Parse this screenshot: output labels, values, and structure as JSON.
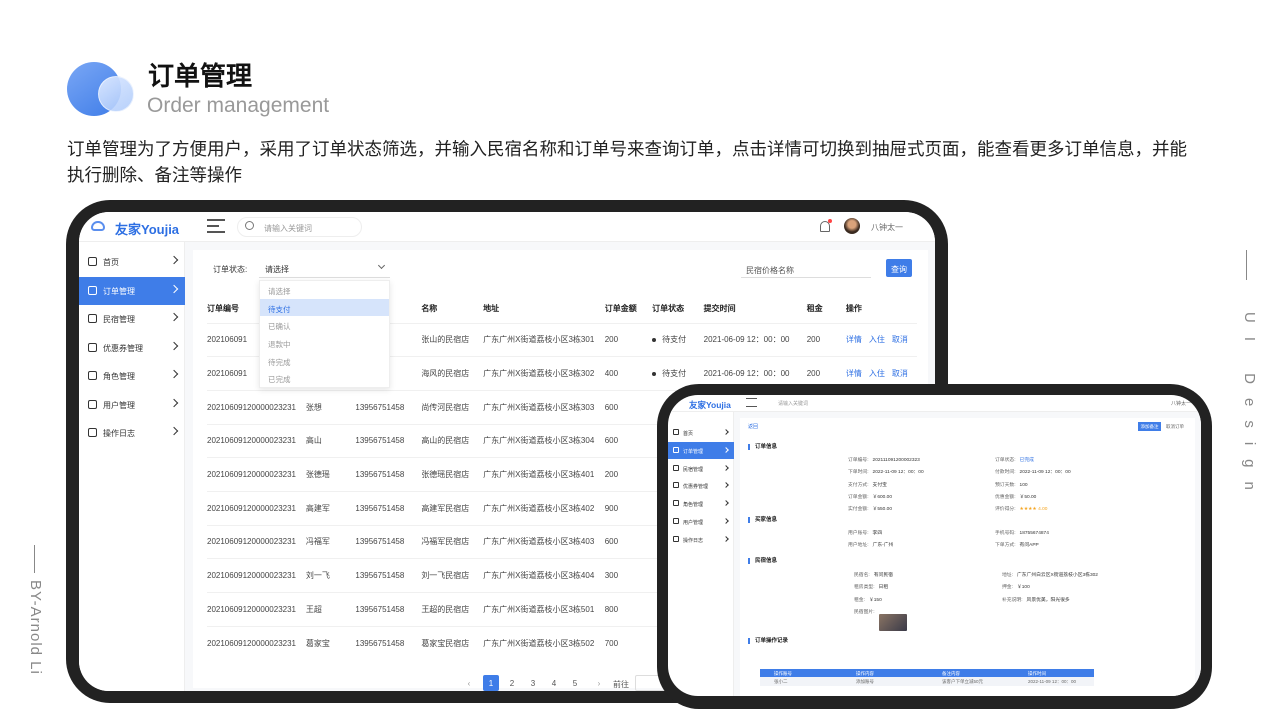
{
  "header": {
    "title": "订单管理",
    "subtitle": "Order management",
    "description": "订单管理为了方便用户，采用了订单状态筛选，并输入民宿名称和订单号来查询订单，点击详情可切换到抽屉式页面，能查看更多订单信息，并能执行删除、备注等操作"
  },
  "side_texts": {
    "author": "BY-Arnold Li",
    "ui_design": "UI Design"
  },
  "app": {
    "brand": "友家Youjia",
    "search_placeholder": "请输入关键词",
    "user_name": "八钟太一",
    "sidebar": [
      {
        "label": "首页",
        "icon": "home-icon"
      },
      {
        "label": "订单管理",
        "icon": "order-icon",
        "active": true
      },
      {
        "label": "民宿管理",
        "icon": "house-icon"
      },
      {
        "label": "优惠券管理",
        "icon": "coupon-icon"
      },
      {
        "label": "角色管理",
        "icon": "role-icon"
      },
      {
        "label": "用户管理",
        "icon": "user-icon"
      },
      {
        "label": "操作日志",
        "icon": "gear-icon"
      }
    ],
    "filter": {
      "status_label": "订单状态:",
      "status_value": "请选择",
      "options": [
        "请选择",
        "待支付",
        "已确认",
        "退款中",
        "待完成",
        "已完成"
      ],
      "selected_option": "待支付",
      "name_placeholder": "民宿价格名称",
      "query_button": "查询"
    },
    "table": {
      "columns": [
        "订单编号",
        "",
        "码",
        "名称",
        "地址",
        "订单金额",
        "订单状态",
        "提交时间",
        "租金",
        "操作"
      ],
      "rows": [
        [
          "202106091",
          "",
          "751458",
          "张山的民宿店",
          "广东广州X街道荔枝小区3栋301",
          "200",
          "待支付",
          "2021-06-09 12：00：00",
          "200",
          "详情|入住|取消"
        ],
        [
          "202106091",
          "",
          "751458",
          "海风的民宿店",
          "广东广州X街道荔枝小区3栋302",
          "400",
          "待支付",
          "2021-06-09 12：00：00",
          "200",
          "详情|入住|取消"
        ],
        [
          "20210609120000023231",
          "张想",
          "13956751458",
          "尚传河民宿店",
          "广东广州X街道荔枝小区3栋303",
          "600",
          "",
          "",
          "",
          ""
        ],
        [
          "20210609120000023231",
          "高山",
          "13956751458",
          "高山的民宿店",
          "广东广州X街道荔枝小区3栋304",
          "600",
          "",
          "",
          "",
          ""
        ],
        [
          "20210609120000023231",
          "张德瑶",
          "13956751458",
          "张德瑶民宿店",
          "广东广州X街道荔枝小区3栋401",
          "200",
          "",
          "",
          "",
          ""
        ],
        [
          "20210609120000023231",
          "高建军",
          "13956751458",
          "高建军民宿店",
          "广东广州X街道荔枝小区3栋402",
          "900",
          "",
          "",
          "",
          ""
        ],
        [
          "20210609120000023231",
          "冯福军",
          "13956751458",
          "冯福军民宿店",
          "广东广州X街道荔枝小区3栋403",
          "600",
          "",
          "",
          "",
          ""
        ],
        [
          "20210609120000023231",
          "刘一飞",
          "13956751458",
          "刘一飞民宿店",
          "广东广州X街道荔枝小区3栋404",
          "300",
          "",
          "",
          "",
          ""
        ],
        [
          "20210609120000023231",
          "王超",
          "13956751458",
          "王超的民宿店",
          "广东广州X街道荔枝小区3栋501",
          "800",
          "",
          "",
          "",
          ""
        ],
        [
          "20210609120000023231",
          "葛家宝",
          "13956751458",
          "葛家宝民宿店",
          "广东广州X街道荔枝小区3栋502",
          "700",
          "",
          "",
          "",
          ""
        ]
      ]
    },
    "pager": {
      "pages": [
        "1",
        "2",
        "3",
        "4",
        "5"
      ],
      "current": "1",
      "goto_label": "前往"
    }
  },
  "detail": {
    "back": "返回",
    "btn_remark": "添加备注",
    "btn_cancel": "取消订单",
    "sections": {
      "order": "订单信息",
      "buyer": "买家信息",
      "house": "民宿信息",
      "log": "订单操作记录"
    },
    "order_left": [
      [
        "订单编号:",
        "202111091200002323"
      ],
      [
        "下单时间:",
        "2022-11-09 12：00：00"
      ],
      [
        "支付方式:",
        "支付宝"
      ],
      [
        "订单金额:",
        "￥600.00"
      ],
      [
        "实付金额:",
        "￥550.00"
      ]
    ],
    "order_right": [
      [
        "订单状态:",
        "已完成"
      ],
      [
        "付款时间:",
        "2022-11-09 12：00：00"
      ],
      [
        "预订天数:",
        "100"
      ],
      [
        "优惠金额:",
        "￥50.00"
      ],
      [
        "评价得分:",
        "★★★★ 4.00"
      ]
    ],
    "buyer_left": [
      [
        "用户账号:",
        "李四"
      ],
      [
        "用户地址:",
        "广东-广州"
      ]
    ],
    "buyer_right": [
      [
        "手机号码:",
        "18755674874"
      ],
      [
        "下单方式:",
        "有问APP"
      ]
    ],
    "house_left": [
      [
        "民宿名:",
        "有问民宿"
      ],
      [
        "租房类型:",
        "日租"
      ],
      [
        "租金:",
        "￥150"
      ],
      [
        "民宿图片:",
        ""
      ]
    ],
    "house_right": [
      [
        "地址:",
        "广东广州白云区X街道荔枝小区3栋302"
      ],
      [
        "押金:",
        "￥100"
      ],
      [
        "补充说明:",
        "风景优美，阳光很多"
      ]
    ],
    "log_columns": [
      "操作账号",
      "操作内容",
      "备注内容",
      "操作时间"
    ],
    "log_row": [
      "张小二",
      "添加账号",
      "该客户下单立减50元",
      "2022-11-09 12：00：00"
    ]
  }
}
